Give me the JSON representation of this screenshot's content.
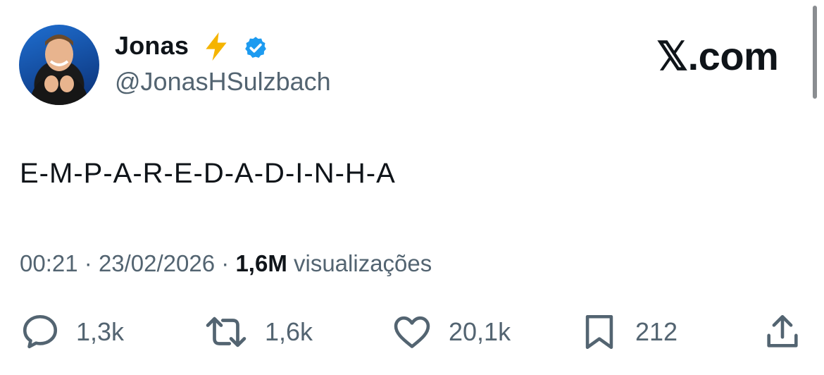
{
  "author": {
    "name": "Jonas",
    "name_emoji": "lightning-icon",
    "verified": true,
    "handle": "@JonasHSulzbach",
    "avatar": "avatar-photo"
  },
  "brand": {
    "text": "𝕏.com"
  },
  "tweet": {
    "text": "E-M-P-A-R-E-D-A-D-I-N-H-A"
  },
  "meta": {
    "time": "00:21",
    "separator": "·",
    "date": "23/02/2026",
    "views_count": "1,6M",
    "views_label": "visualizações"
  },
  "actions": {
    "replies": "1,3k",
    "retweets": "1,6k",
    "likes": "20,1k",
    "bookmarks": "212"
  },
  "colors": {
    "text": "#0f1419",
    "muted": "#536471",
    "verified": "#1d9bf0",
    "bolt": "#f5b400"
  }
}
